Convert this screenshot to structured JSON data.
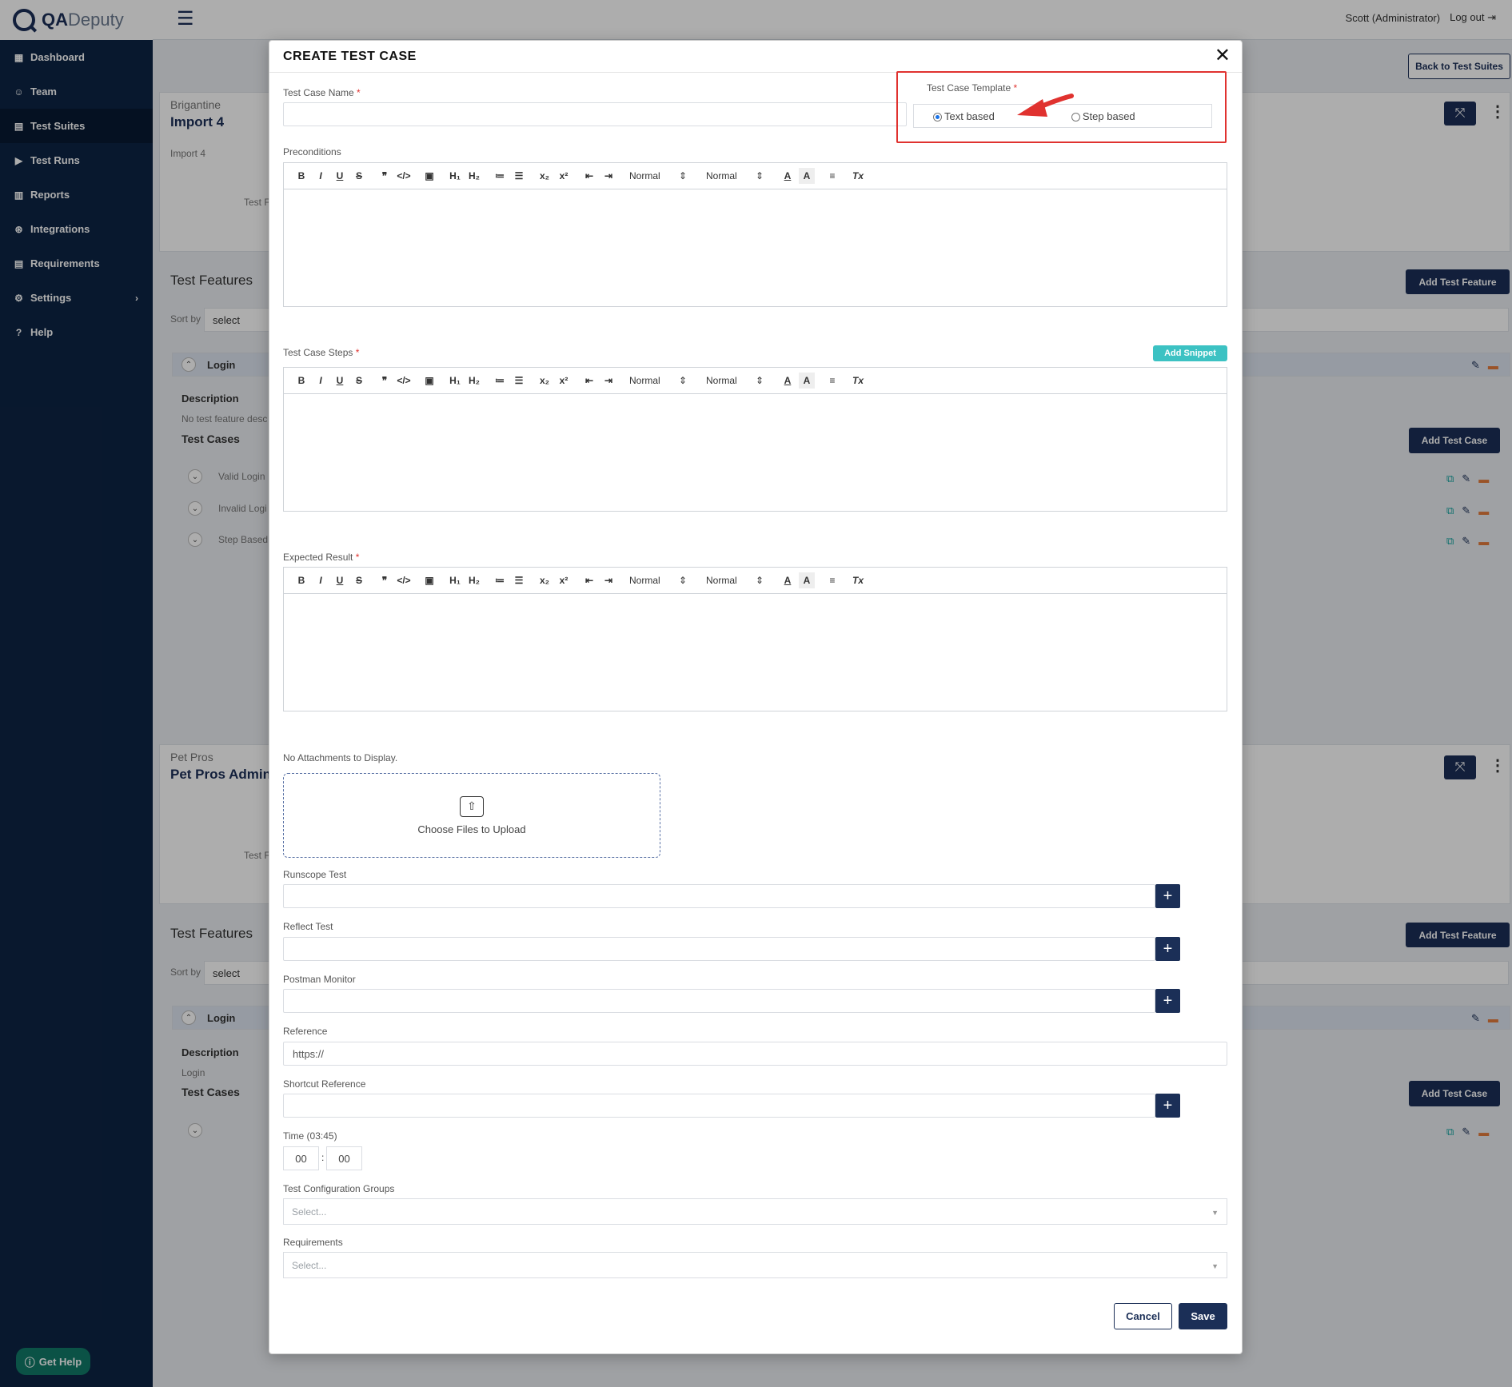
{
  "app": {
    "logo_main": "QA",
    "logo_sub": "Deputy"
  },
  "header": {
    "user_label": "Scott (Administrator)",
    "logout_label": "Log out"
  },
  "sidebar": {
    "items": [
      {
        "label": "Dashboard",
        "icon": "dashboard-icon"
      },
      {
        "label": "Team",
        "icon": "team-icon"
      },
      {
        "label": "Test Suites",
        "icon": "test-suites-icon"
      },
      {
        "label": "Test Runs",
        "icon": "test-runs-icon"
      },
      {
        "label": "Reports",
        "icon": "reports-icon"
      },
      {
        "label": "Integrations",
        "icon": "integrations-icon"
      },
      {
        "label": "Requirements",
        "icon": "requirements-icon"
      },
      {
        "label": "Settings",
        "icon": "gear-icon"
      },
      {
        "label": "Help",
        "icon": "help-icon"
      }
    ],
    "get_help_label": "Get Help"
  },
  "background": {
    "back_button": "Back to Test Suites",
    "suite1": {
      "project": "Brigantine",
      "name": "Import 4",
      "sub": "Import 4",
      "test_label": "Test F"
    },
    "features_heading": "Test Features",
    "add_feature_button": "Add Test Feature",
    "sort_label": "Sort by",
    "sort_value": "select",
    "feature_name": "Login",
    "description_heading": "Description",
    "description_text1": "No test feature desc",
    "description_text2": "Login",
    "test_cases_heading": "Test Cases",
    "add_case_button": "Add Test Case",
    "cases": [
      "Valid Login",
      "Invalid Logi",
      "Step Based"
    ],
    "suite2": {
      "project": "Pet Pros",
      "name": "Pet Pros Admin",
      "test_label": "Test F"
    }
  },
  "modal": {
    "title": "CREATE TEST CASE",
    "name_label": "Test Case Name",
    "template_label": "Test Case Template",
    "template_options": [
      "Text based",
      "Step based"
    ],
    "template_selected": "Text based",
    "preconditions_label": "Preconditions",
    "steps_label": "Test Case Steps",
    "add_snippet_label": "Add Snippet",
    "expected_label": "Expected Result",
    "toolbar": {
      "bold": "B",
      "italic": "I",
      "underline": "U",
      "strike": "S",
      "quote": "❞",
      "code": "</>",
      "image": "▣",
      "h1": "H₁",
      "h2": "H₂",
      "ol": "≔",
      "ul": "☰",
      "sub": "x₂",
      "sup": "x²",
      "outdent": "⇤",
      "indent": "⇥",
      "size": "Normal",
      "font": "Normal",
      "color": "A",
      "bg": "A",
      "align": "≡",
      "clear": "Tx"
    },
    "attachments_label": "No Attachments to Display.",
    "upload_label": "Choose Files to Upload",
    "runscope_label": "Runscope Test",
    "reflect_label": "Reflect Test",
    "postman_label": "Postman Monitor",
    "reference_label": "Reference",
    "reference_value": "https://",
    "shortcut_label": "Shortcut Reference",
    "time_label": "Time (03:45)",
    "time_hours": "00",
    "time_minutes": "00",
    "config_groups_label": "Test Configuration Groups",
    "config_groups_placeholder": "Select...",
    "requirements_label": "Requirements",
    "requirements_placeholder": "Select...",
    "cancel_label": "Cancel",
    "save_label": "Save"
  },
  "colors": {
    "brand": "#1b2f57",
    "sidebar": "#0d2444",
    "highlight": "#e0322f",
    "snippet": "#3cc2c3"
  }
}
